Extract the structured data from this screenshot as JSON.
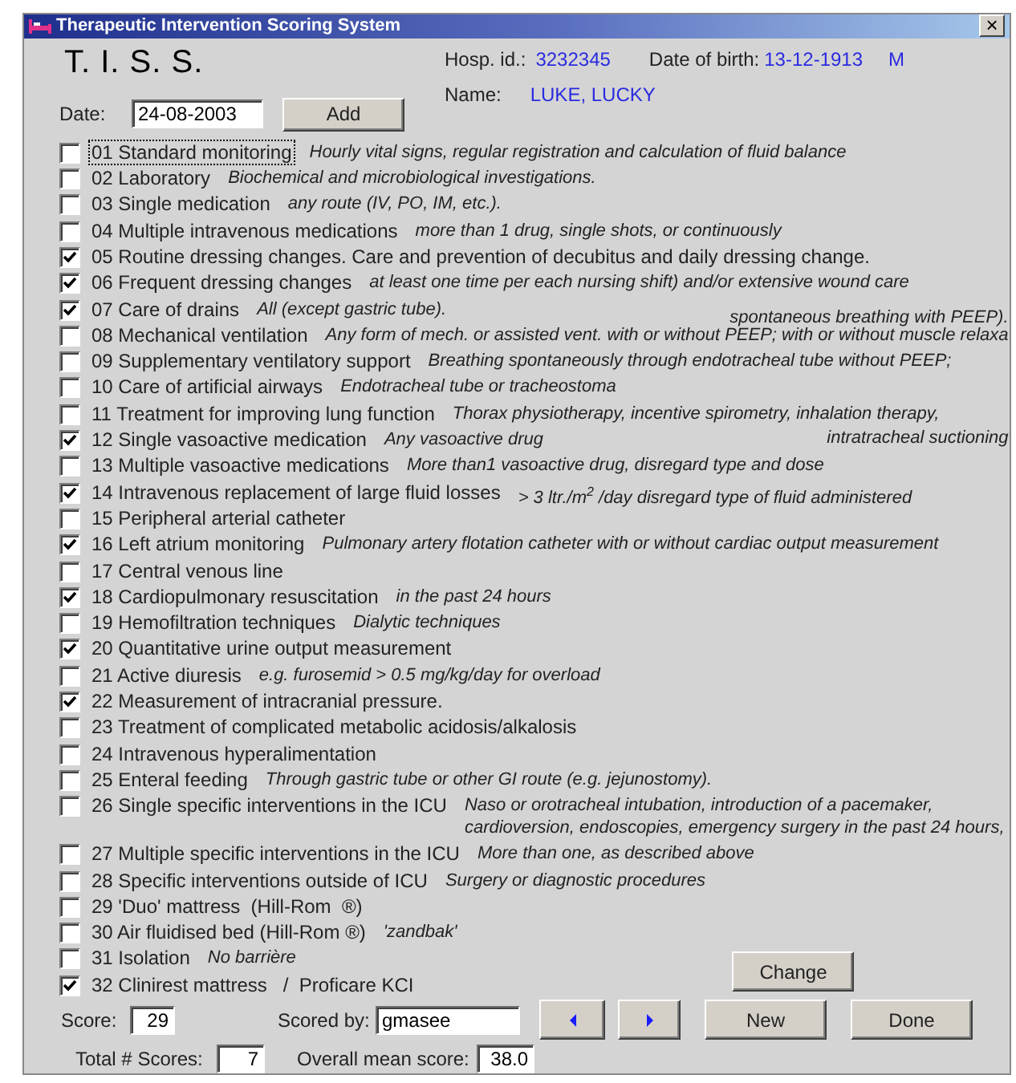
{
  "window": {
    "title": "Therapeutic Intervention Scoring System",
    "close": "×"
  },
  "header": {
    "heading": "T. I. S. S.",
    "hosp_label": "Hosp. id.:",
    "hosp_id": "3232345",
    "dob_label": "Date of birth:",
    "dob": "13-12-1913",
    "sex": "M",
    "name_label": "Name:",
    "name": "LUKE, LUCKY",
    "date_label": "Date:",
    "date": "24-08-2003",
    "add_button": "Add"
  },
  "items": [
    {
      "label": "01 Standard monitoring",
      "description": "Hourly vital signs, regular registration and calculation of fluid balance",
      "checked": false,
      "focused": true
    },
    {
      "label": "02 Laboratory",
      "description": "Biochemical and microbiological investigations.",
      "checked": false,
      "focused": false
    },
    {
      "label": "03 Single medication",
      "description": "any route (IV, PO, IM, etc.).",
      "checked": false,
      "focused": false
    },
    {
      "label": "04 Multiple intravenous medications",
      "description": "more than 1 drug, single shots, or continuously",
      "checked": false,
      "focused": false
    },
    {
      "label": "05 Routine dressing changes. Care and prevention of decubitus and daily dressing change.",
      "checked": true,
      "focused": false
    },
    {
      "label": "06 Frequent dressing changes",
      "description": "at least one time per each nursing shift) and/or extensive wound care",
      "checked": true,
      "focused": false
    },
    {
      "label": "07 Care of drains",
      "description": "All (except gastric tube).",
      "note": "spontaneous breathing with PEEP).",
      "checked": true,
      "focused": false
    },
    {
      "label": "08 Mechanical ventilation",
      "description": "Any form of mech. or assisted vent. with or without PEEP; with or without muscle relaxa",
      "checked": false,
      "focused": false
    },
    {
      "label": "09 Supplementary ventilatory support",
      "description": "Breathing spontaneously through endotracheal tube without PEEP;",
      "checked": false,
      "focused": false
    },
    {
      "label": "10 Care of artificial airways",
      "description": "Endotracheal tube or tracheostoma",
      "checked": false,
      "focused": false
    },
    {
      "label": "11 Treatment for improving lung function",
      "description": "Thorax physiotherapy, incentive spirometry, inhalation therapy,",
      "checked": false,
      "focused": false
    },
    {
      "label": "12 Single vasoactive medication",
      "description": "Any vasoactive drug",
      "note": "intratracheal suctioning",
      "checked": true,
      "focused": false
    },
    {
      "label": "13 Multiple vasoactive medications",
      "description": "More than1 vasoactive drug, disregard type and dose",
      "checked": false,
      "focused": false
    },
    {
      "label": "14 Intravenous replacement of large fluid losses",
      "description": "> 3 ltr./m$^{2}$ /day disregard type of fluid administered",
      "checked": true,
      "focused": false
    },
    {
      "label": "15 Peripheral arterial catheter",
      "checked": false,
      "focused": false
    },
    {
      "label": "16 Left atrium monitoring",
      "description": "Pulmonary artery flotation catheter with or without cardiac output measurement",
      "checked": true,
      "focused": false
    },
    {
      "label": "17 Central venous line",
      "checked": false,
      "focused": false
    },
    {
      "label": "18 Cardiopulmonary resuscitation",
      "description": "in the past 24 hours",
      "checked": true,
      "focused": false
    },
    {
      "label": "19 Hemofiltration techniques",
      "description": "Dialytic techniques",
      "checked": false,
      "focused": false
    },
    {
      "label": "20 Quantitative urine output measurement",
      "checked": true,
      "focused": false
    },
    {
      "label": "21 Active diuresis",
      "description": "e.g. furosemid > 0.5 mg/kg/day for overload",
      "checked": false,
      "focused": false
    },
    {
      "label": "22 Measurement of intracranial pressure.",
      "checked": true,
      "focused": false
    },
    {
      "label": "23 Treatment of complicated metabolic acidosis/alkalosis",
      "checked": false,
      "focused": false
    },
    {
      "label": "24 Intravenous hyperalimentation",
      "checked": false,
      "focused": false
    },
    {
      "label": "25 Enteral feeding",
      "description": "Through gastric tube or other GI route (e.g. jejunostomy).",
      "checked": false,
      "focused": false
    },
    {
      "label": "26 Single specific interventions in the ICU",
      "description": "Naso or orotracheal intubation, introduction of a pacemaker,",
      "description_2": "cardioversion, endoscopies, emergency surgery in the past 24 hours,",
      "checked": false,
      "focused": false
    },
    {
      "label": "27 Multiple specific interventions in the ICU",
      "description": "More than one, as described above",
      "checked": false,
      "focused": false
    },
    {
      "label": "28 Specific interventions outside of ICU",
      "description": "Surgery or diagnostic procedures",
      "checked": false,
      "focused": false
    },
    {
      "label": "29 'Duo' mattress  (Hill-Rom  ®)",
      "checked": false,
      "focused": false
    },
    {
      "label": "30 Air fluidised bed (Hill-Rom ®)",
      "description": "'zandbak'",
      "checked": false,
      "focused": false
    },
    {
      "label": "31 Isolation",
      "description": "No barrière",
      "checked": false,
      "focused": false
    },
    {
      "label": "32 Clinirest mattress   /  Proficare KCI",
      "checked": true,
      "focused": false
    }
  ],
  "footer": {
    "change_button": "Change",
    "score_label": "Score:",
    "score": "29",
    "scored_by_label": "Scored by:",
    "scored_by": "gmasee",
    "new_button": "New",
    "done_button": "Done",
    "total_label": "Total # Scores:",
    "total": "7",
    "mean_label": "Overall mean score:",
    "mean": "38.0"
  }
}
